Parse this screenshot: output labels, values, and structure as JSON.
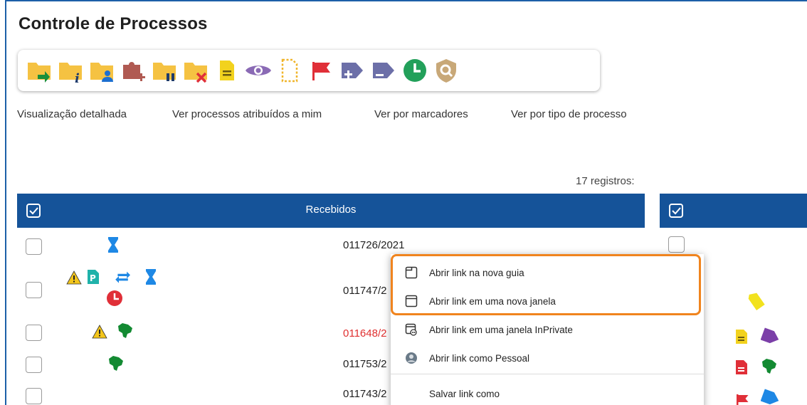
{
  "page": {
    "title": "Controle de Processos"
  },
  "toolbar": {
    "buttons": [
      {
        "name": "folder-arrow-icon",
        "color": "#f5c242"
      },
      {
        "name": "folder-info-icon",
        "color": "#f5c242"
      },
      {
        "name": "folder-user-icon",
        "color": "#f5c242"
      },
      {
        "name": "puzzle-plus-icon",
        "color": "#b05a52"
      },
      {
        "name": "folder-pause-icon",
        "color": "#f5c242"
      },
      {
        "name": "folder-close-icon",
        "color": "#f5c242"
      },
      {
        "name": "document-note-icon",
        "color": "#f2d21e"
      },
      {
        "name": "eye-icon",
        "color": "#8a6ab5"
      },
      {
        "name": "document-dashed-icon",
        "color": "#f0b52a"
      },
      {
        "name": "flag-icon",
        "color": "#e02f38"
      },
      {
        "name": "tag-plus-icon",
        "color": "#6c6fa8"
      },
      {
        "name": "tag-minus-icon",
        "color": "#6c6fa8"
      },
      {
        "name": "clock-icon",
        "color": "#22a05a"
      },
      {
        "name": "shield-search-icon",
        "color": "#c8a878"
      }
    ]
  },
  "tabs": [
    {
      "label": "Visualização detalhada"
    },
    {
      "label": "Ver processos atribuídos a mim"
    },
    {
      "label": "Ver por marcadores"
    },
    {
      "label": "Ver por tipo de processo"
    }
  ],
  "records": {
    "count_label": "17 registros:"
  },
  "table": {
    "header": "Recebidos",
    "rows": [
      {
        "number": "011726/2021",
        "color": "#222222"
      },
      {
        "number": "011747/2",
        "color": "#222222"
      },
      {
        "number": "011648/2",
        "color": "#e03030"
      },
      {
        "number": "011753/2",
        "color": "#222222"
      },
      {
        "number": "011743/2",
        "color": "#222222"
      }
    ]
  },
  "context_menu": {
    "items": [
      {
        "label": "Abrir link na nova guia",
        "icon": "new-tab-icon"
      },
      {
        "label": "Abrir link em uma nova janela",
        "icon": "new-window-icon"
      },
      {
        "label": "Abrir link em uma janela InPrivate",
        "icon": "inprivate-window-icon"
      },
      {
        "label": "Abrir link como Pessoal",
        "icon": "profile-avatar-icon"
      },
      {
        "label": "Salvar link como",
        "icon": ""
      }
    ]
  },
  "colors": {
    "header_blue": "#155399",
    "highlight_orange": "#f0841e",
    "red_number": "#e03030"
  }
}
